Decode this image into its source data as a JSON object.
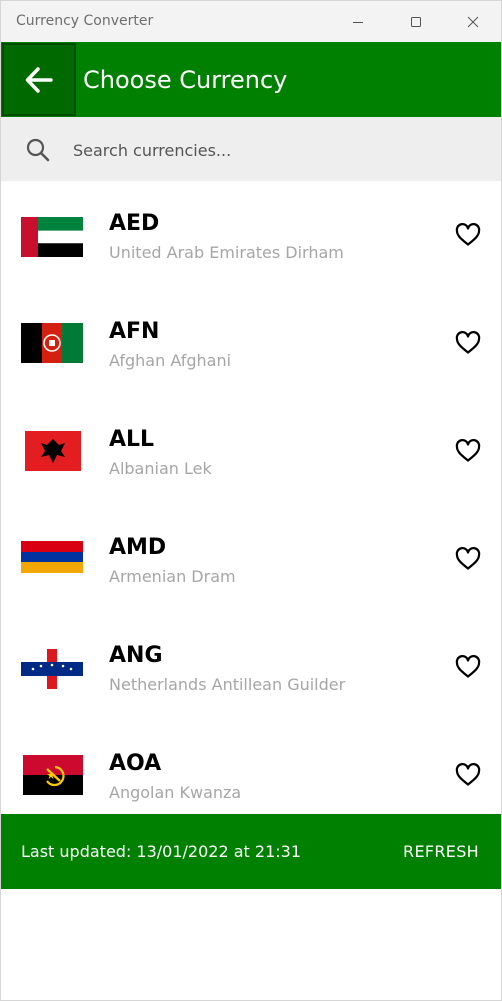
{
  "window": {
    "title": "Currency Converter",
    "controls": [
      "minimize-icon",
      "maximize-icon",
      "close-icon"
    ]
  },
  "header": {
    "back_icon": "arrow-left-icon",
    "title": "Choose Currency",
    "color": "#008000"
  },
  "search": {
    "icon": "search-icon",
    "placeholder": "Search currencies...",
    "value": ""
  },
  "currencies": [
    {
      "code": "AED",
      "name": "United Arab Emirates Dirham",
      "flag": "flag-uae-icon",
      "favorite": false
    },
    {
      "code": "AFN",
      "name": "Afghan Afghani",
      "flag": "flag-afghanistan-icon",
      "favorite": false
    },
    {
      "code": "ALL",
      "name": "Albanian Lek",
      "flag": "flag-albania-icon",
      "favorite": false
    },
    {
      "code": "AMD",
      "name": "Armenian Dram",
      "flag": "flag-armenia-icon",
      "favorite": false
    },
    {
      "code": "ANG",
      "name": "Netherlands Antillean Guilder",
      "flag": "flag-netherlands-antilles-icon",
      "favorite": false
    },
    {
      "code": "AOA",
      "name": "Angolan Kwanza",
      "flag": "flag-angola-icon",
      "favorite": false
    }
  ],
  "footer": {
    "updated_text": "Last updated: 13/01/2022 at 21:31",
    "refresh_label": "REFRESH",
    "color": "#008000"
  }
}
